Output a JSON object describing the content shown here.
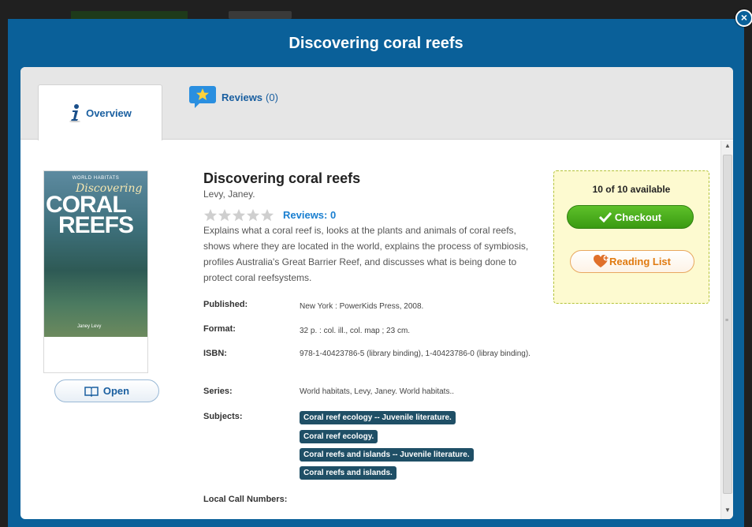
{
  "modal": {
    "title": "Discovering coral reefs",
    "close_symbol": "×"
  },
  "tabs": {
    "overview": {
      "label": "Overview",
      "icon": "info-icon"
    },
    "reviews": {
      "label": "Reviews",
      "count": "(0)",
      "icon": "star-speech-icon"
    }
  },
  "book": {
    "cover": {
      "series": "WORLD HABITATS",
      "title_line1": "Discovering",
      "title_line2": "CORAL",
      "title_line3": "REEFS",
      "author": "Janey Levy"
    },
    "title": "Discovering coral reefs",
    "author": "Levy, Janey.",
    "rating_stars": 0,
    "reviews_label": "Reviews: 0",
    "description": "Explains what a coral reef is, looks at the plants and animals of coral reefs, shows where they are located in the world, explains the process of symbiosis, profiles Australia's Great Barrier Reef, and discusses what is being done to protect coral reefsystems.",
    "open_label": "Open"
  },
  "details": {
    "published_label": "Published:",
    "published": "New York : PowerKids Press, 2008.",
    "format_label": "Format:",
    "format": "32 p. : col. ill., col. map ; 23 cm.",
    "isbn_label": "ISBN:",
    "isbn": "978-1-40423786-5 (library binding), 1-40423786-0 (libray binding).",
    "series_label": "Series:",
    "series": "World habitats, Levy, Janey. World habitats..",
    "subjects_label": "Subjects:",
    "subjects": [
      "Coral reef ecology -- Juvenile literature.",
      "Coral reef ecology.",
      "Coral reefs and islands -- Juvenile literature.",
      "Coral reefs and islands."
    ],
    "call_numbers_label": "Local Call Numbers:"
  },
  "availability": {
    "text": "10 of 10 available",
    "checkout_label": "Checkout",
    "reading_list_label": "Reading List"
  },
  "colors": {
    "modal_blue": "#0a6099",
    "checkout_green": "#4aad1e",
    "subject_tag": "#1f4f66",
    "link_blue": "#1a7fd0"
  }
}
